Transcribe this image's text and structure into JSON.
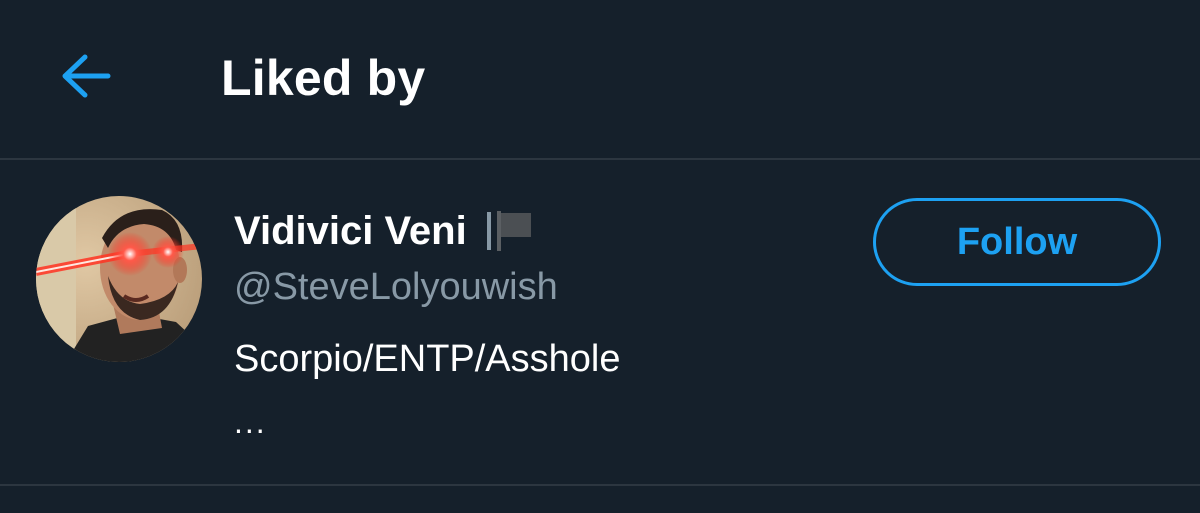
{
  "header": {
    "back_icon": "arrow-left-icon",
    "title": "Liked by"
  },
  "user": {
    "display_name": "Vidivici Veni",
    "name_icon": "flag-icon",
    "handle": "@SteveLolyouwish",
    "bio": "Scorpio/ENTP/Asshole",
    "bio_more": "...",
    "follow_label": "Follow"
  },
  "colors": {
    "background": "#15202b",
    "divider": "#2c3640",
    "accent": "#1da1f2",
    "secondary_text": "#8899a6",
    "primary_text": "#ffffff"
  }
}
